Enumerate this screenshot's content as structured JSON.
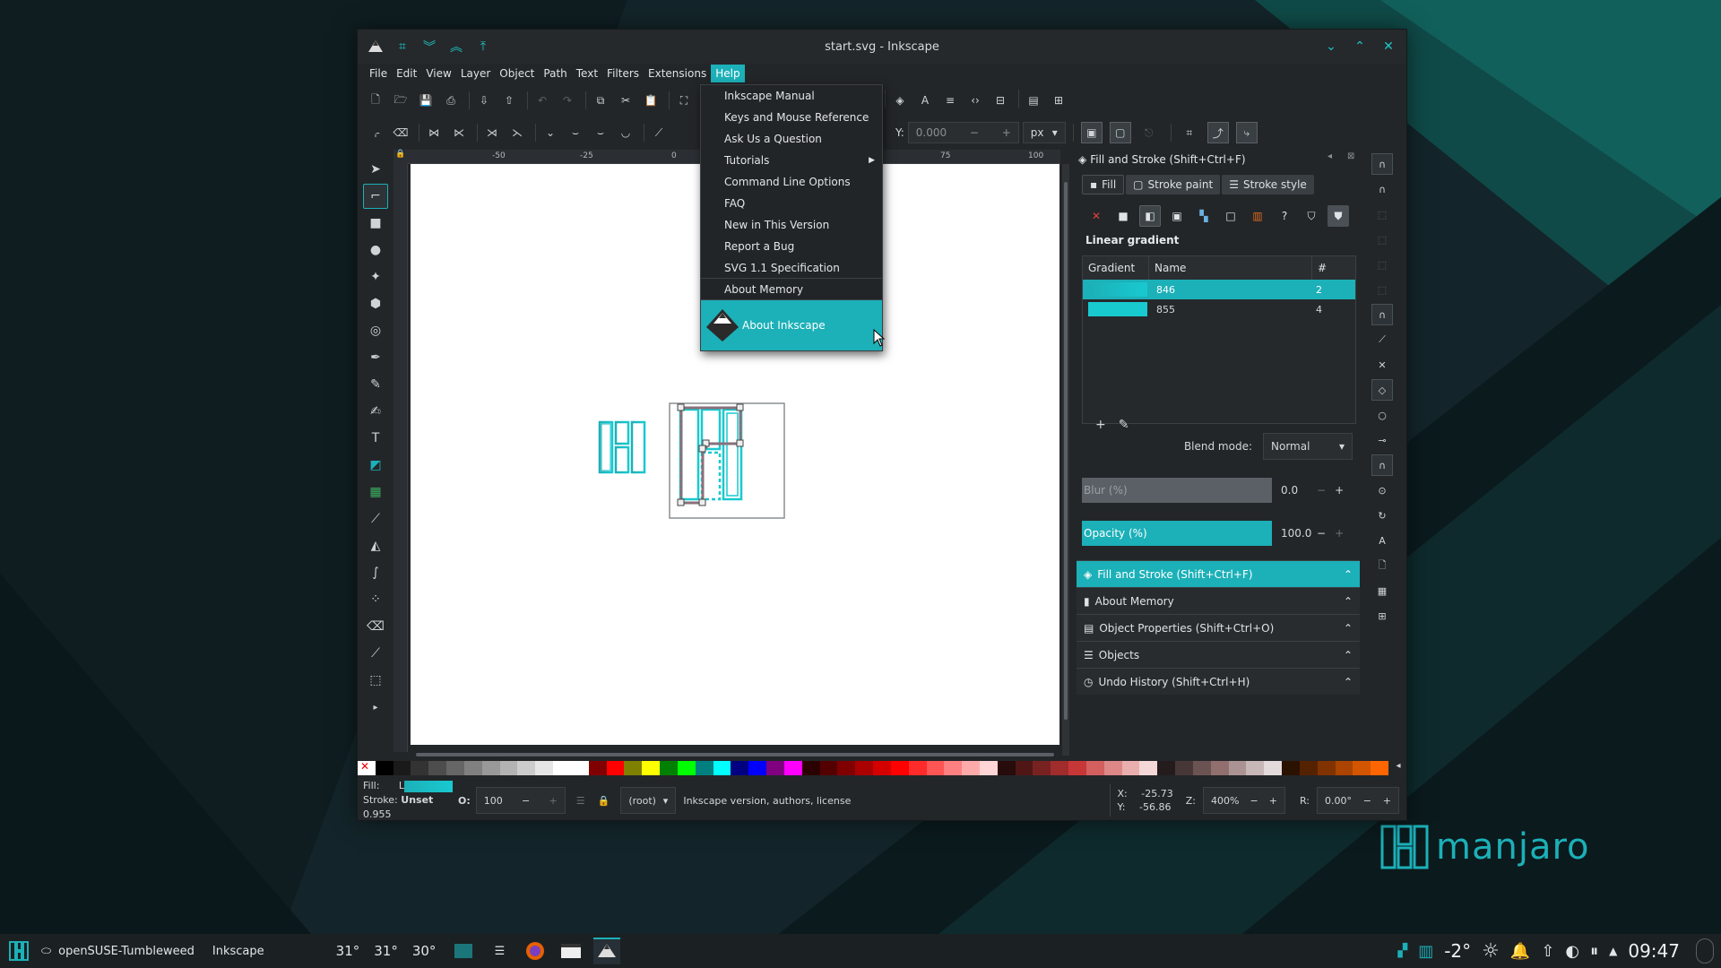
{
  "window": {
    "title": "start.svg - Inkscape"
  },
  "menubar": [
    "File",
    "Edit",
    "View",
    "Layer",
    "Object",
    "Path",
    "Text",
    "Filters",
    "Extensions",
    "Help"
  ],
  "help_menu": {
    "items": [
      "Inkscape Manual",
      "Keys and Mouse Reference",
      "Ask Us a Question",
      "Tutorials",
      "Command Line Options",
      "FAQ",
      "New in This Version",
      "Report a Bug",
      "SVG 1.1 Specification",
      "About Memory"
    ],
    "highlighted": "About Inkscape"
  },
  "toolbar": {
    "y_label": "Y:",
    "y_value": "0.000",
    "unit": "px"
  },
  "ruler_marks": [
    "-50",
    "-25",
    "0",
    "25",
    "50",
    "75",
    "100"
  ],
  "fill_stroke": {
    "title": "Fill and Stroke (Shift+Ctrl+F)",
    "tabs": [
      "Fill",
      "Stroke paint",
      "Stroke style"
    ],
    "paint_type": "Linear gradient",
    "columns": [
      "Gradient",
      "Name",
      "#"
    ],
    "gradients": [
      {
        "name": "846",
        "count": "2"
      },
      {
        "name": "855",
        "count": "4"
      }
    ],
    "blend_label": "Blend mode:",
    "blend_value": "Normal",
    "blur_label": "Blur (%)",
    "blur_value": "0.0",
    "opacity_label": "Opacity (%)",
    "opacity_value": "100.0"
  },
  "docks": [
    {
      "label": "Fill and Stroke (Shift+Ctrl+F)",
      "active": true
    },
    {
      "label": "About Memory",
      "active": false
    },
    {
      "label": "Object Properties (Shift+Ctrl+O)",
      "active": false
    },
    {
      "label": "Objects",
      "active": false
    },
    {
      "label": "Undo History (Shift+Ctrl+H)",
      "active": false
    }
  ],
  "status": {
    "fill_label": "Fill:",
    "fill_value": "L",
    "stroke_label": "Stroke:",
    "stroke_value": "Unset",
    "stroke_width": "0.955",
    "opacity_label": "O:",
    "opacity_value": "100",
    "layer": "(root)",
    "message": "Inkscape version, authors, license",
    "x_label": "X:",
    "x_value": "-25.73",
    "y_label": "Y:",
    "y_value": "-56.86",
    "zoom_label": "Z:",
    "zoom_value": "400%",
    "rotate_label": "R:",
    "rotate_value": "0.00°"
  },
  "taskbar": {
    "activity": "openSUSE-Tumbleweed",
    "app": "Inkscape",
    "temps": [
      "31°",
      "31°",
      "30°"
    ],
    "weather_temp": "-2°",
    "clock": "09:47"
  },
  "brand": "manjaro",
  "colors": {
    "accent": "#1cb0b8",
    "window_bg": "#232629"
  }
}
